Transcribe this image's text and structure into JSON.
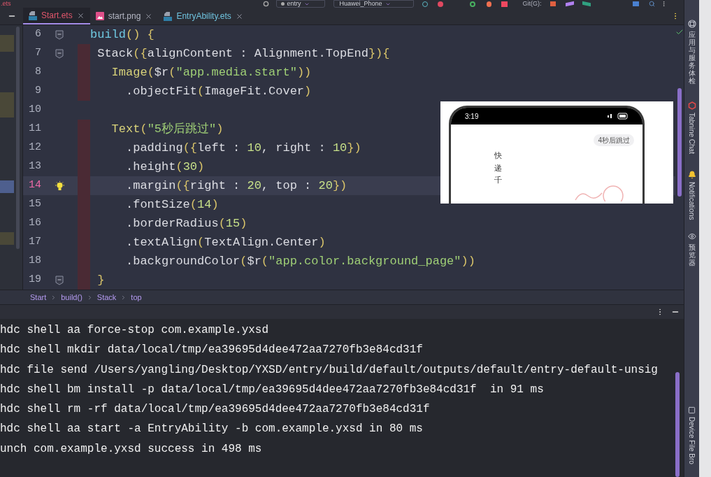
{
  "toolbar": {
    "file_fragment": ".ets",
    "module": "entry",
    "device": "Huawei_Phone",
    "vcs_label": "Git(G):"
  },
  "tabs": [
    {
      "label": "Start.ets",
      "kind": "code",
      "selected": true,
      "color": "#e0566b"
    },
    {
      "label": "start.png",
      "kind": "image",
      "selected": false,
      "color": "#b4b7c4"
    },
    {
      "label": "EntryAbility.ets",
      "kind": "code",
      "selected": false,
      "color": "#6fc3df"
    }
  ],
  "editor": {
    "lines": [
      {
        "number": "6",
        "fold": true,
        "current": false,
        "tokens": [
          {
            "text": "build",
            "kind": "name"
          },
          {
            "text": "() {",
            "kind": "punct"
          }
        ]
      },
      {
        "number": "7",
        "fold": true,
        "current": false,
        "tokens": [
          {
            "text": " Stack",
            "kind": "plain"
          },
          {
            "text": "({",
            "kind": "punct"
          },
          {
            "text": "alignContent : Alignment.TopEnd",
            "kind": "plain"
          },
          {
            "text": "}){",
            "kind": "punct"
          }
        ]
      },
      {
        "number": "8",
        "fold": false,
        "current": false,
        "tokens": [
          {
            "text": "   Image",
            "kind": "component"
          },
          {
            "text": "(",
            "kind": "punct"
          },
          {
            "text": "$r",
            "kind": "plain"
          },
          {
            "text": "(",
            "kind": "punct"
          },
          {
            "text": "\"app.media.start\"",
            "kind": "string"
          },
          {
            "text": "))",
            "kind": "punct"
          }
        ]
      },
      {
        "number": "9",
        "fold": false,
        "current": false,
        "tokens": [
          {
            "text": "     .objectFit",
            "kind": "plain"
          },
          {
            "text": "(",
            "kind": "punct"
          },
          {
            "text": "ImageFit.Cover",
            "kind": "plain"
          },
          {
            "text": ")",
            "kind": "punct"
          }
        ]
      },
      {
        "number": "10",
        "fold": false,
        "current": false
      },
      {
        "number": "11",
        "fold": false,
        "current": false,
        "tokens": [
          {
            "text": "   Text",
            "kind": "component"
          },
          {
            "text": "(",
            "kind": "punct"
          },
          {
            "text": "\"5秒后跳过\"",
            "kind": "string"
          },
          {
            "text": ")",
            "kind": "punct"
          }
        ]
      },
      {
        "number": "12",
        "fold": false,
        "current": false,
        "tokens": [
          {
            "text": "     .padding",
            "kind": "plain"
          },
          {
            "text": "({",
            "kind": "punct"
          },
          {
            "text": "left : ",
            "kind": "plain"
          },
          {
            "text": "10",
            "kind": "number"
          },
          {
            "text": ", right : ",
            "kind": "plain"
          },
          {
            "text": "10",
            "kind": "number"
          },
          {
            "text": "})",
            "kind": "punct"
          }
        ]
      },
      {
        "number": "13",
        "fold": false,
        "current": false,
        "tokens": [
          {
            "text": "     .height",
            "kind": "plain"
          },
          {
            "text": "(",
            "kind": "punct"
          },
          {
            "text": "30",
            "kind": "number"
          },
          {
            "text": ")",
            "kind": "punct"
          }
        ]
      },
      {
        "number": "14",
        "fold": false,
        "current": true,
        "tokens": [
          {
            "text": "     .margin",
            "kind": "plain"
          },
          {
            "text": "({",
            "kind": "punct"
          },
          {
            "text": "right : ",
            "kind": "plain"
          },
          {
            "text": "20",
            "kind": "number"
          },
          {
            "text": ", top : ",
            "kind": "plain"
          },
          {
            "text": "20",
            "kind": "number"
          },
          {
            "text": "})",
            "kind": "punct"
          }
        ]
      },
      {
        "number": "15",
        "fold": false,
        "current": false,
        "tokens": [
          {
            "text": "     .fontSize",
            "kind": "plain"
          },
          {
            "text": "(",
            "kind": "punct"
          },
          {
            "text": "14",
            "kind": "number"
          },
          {
            "text": ")",
            "kind": "punct"
          }
        ]
      },
      {
        "number": "16",
        "fold": false,
        "current": false,
        "tokens": [
          {
            "text": "     .borderRadius",
            "kind": "plain"
          },
          {
            "text": "(",
            "kind": "punct"
          },
          {
            "text": "15",
            "kind": "number"
          },
          {
            "text": ")",
            "kind": "punct"
          }
        ]
      },
      {
        "number": "17",
        "fold": false,
        "current": false,
        "tokens": [
          {
            "text": "     .textAlign",
            "kind": "plain"
          },
          {
            "text": "(",
            "kind": "punct"
          },
          {
            "text": "TextAlign.Center",
            "kind": "plain"
          },
          {
            "text": ")",
            "kind": "punct"
          }
        ]
      },
      {
        "number": "18",
        "fold": false,
        "current": false,
        "tokens": [
          {
            "text": "     .backgroundColor",
            "kind": "plain"
          },
          {
            "text": "(",
            "kind": "punct"
          },
          {
            "text": "$r",
            "kind": "plain"
          },
          {
            "text": "(",
            "kind": "punct"
          },
          {
            "text": "\"app.color.background_page\"",
            "kind": "string"
          },
          {
            "text": "))",
            "kind": "punct"
          }
        ]
      },
      {
        "number": "19",
        "fold": true,
        "current": false,
        "tokens": [
          {
            "text": " }",
            "kind": "punct"
          }
        ]
      }
    ]
  },
  "preview": {
    "time": "3:19",
    "skip_button": "4秒后跳过",
    "vertical_text": "快递千"
  },
  "breadcrumb": [
    "Start",
    "build()",
    "Stack",
    "top"
  ],
  "console": {
    "lines": [
      "hdc shell aa force-stop com.example.yxsd",
      "hdc shell mkdir data/local/tmp/ea39695d4dee472aa7270fb3e84cd31f",
      "hdc file send /Users/yangling/Desktop/YXSD/entry/build/default/outputs/default/entry-default-unsig",
      "hdc shell bm install -p data/local/tmp/ea39695d4dee472aa7270fb3e84cd31f  in 91 ms",
      "hdc shell rm -rf data/local/tmp/ea39695d4dee472aa7270fb3e84cd31f",
      "hdc shell aa start -a EntryAbility -b com.example.yxsd in 80 ms",
      "unch com.example.yxsd success in 498 ms"
    ]
  },
  "tool_windows": [
    {
      "label": "应用与服务体检",
      "kind": "cjk"
    },
    {
      "label": "Tabnine Chat",
      "kind": "latin"
    },
    {
      "label": "Notifications",
      "kind": "latin"
    },
    {
      "label": "预览器",
      "kind": "cjk"
    },
    {
      "label": "Device File Bro",
      "kind": "latin"
    }
  ]
}
